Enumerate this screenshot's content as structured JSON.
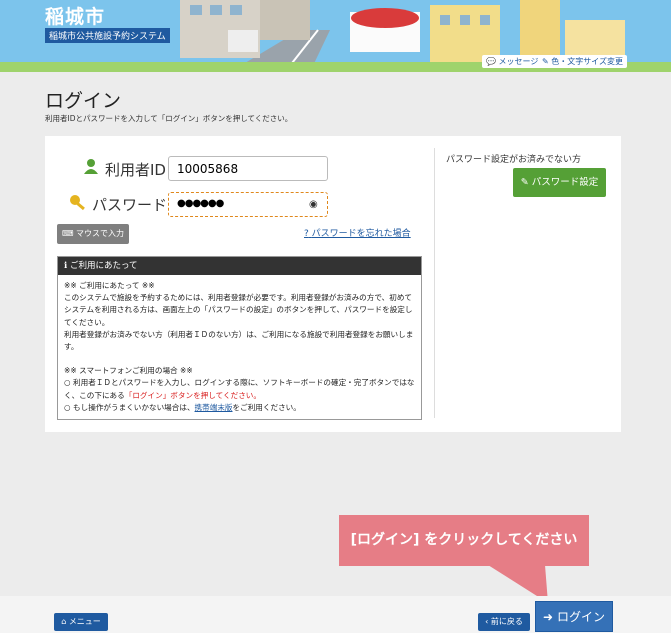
{
  "header": {
    "city": "稲城市",
    "system": "稲城市公共施設予約システム",
    "message_link": "メッセージ",
    "display_link": "色・文字サイズ変更"
  },
  "page": {
    "title": "ログイン",
    "subtitle": "利用者IDとパスワードを入力して「ログイン」ボタンを押してください。"
  },
  "form": {
    "user_id_label": "利用者ID",
    "user_id_value": "10005868",
    "password_label": "パスワード",
    "password_value": "●●●●●●",
    "mouse_input_label": "マウスで入力",
    "forgot_label": "パスワードを忘れた場合"
  },
  "notice": {
    "title": "ご利用にあたって",
    "p1_heading": "※※ ご利用にあたって ※※",
    "p1_text": "このシステムで施設を予約するためには、利用者登録が必要です。利用者登録がお済みの方で、初めてシステムを利用される方は、画面左上の「パスワードの設定」のボタンを押して、パスワードを設定してください。",
    "p2_text": "利用者登録がお済みでない方（利用者ＩＤのない方）は、ご利用になる施設で利用者登録をお願いします。",
    "p3_heading": "※※ スマートフォンご利用の場合 ※※",
    "p3_line1": "○ 利用者ＩＤとパスワードを入力し、ログインする際に、ソフトキーボードの確定・完了ボタンではなく、この下にある",
    "p3_red": "「ログイン」ボタンを押してください。",
    "p3_line2_pre": "○ もし操作がうまくいかない場合は、",
    "p3_link": "携帯端末版",
    "p3_line2_post": "をご利用ください。"
  },
  "side": {
    "pw_not_set_text": "パスワード設定がお済みでない方",
    "pw_set_button": "パスワード設定"
  },
  "footer": {
    "menu_button": "メニュー",
    "back_button": "前に戻る",
    "login_button": "ログイン"
  },
  "callout": {
    "text": "[ログイン] をクリックしてください"
  },
  "colors": {
    "header_bg": "#7cc4ec",
    "primary_blue": "#1f5aa0",
    "green": "#55a036",
    "callout": "#e67d86"
  }
}
